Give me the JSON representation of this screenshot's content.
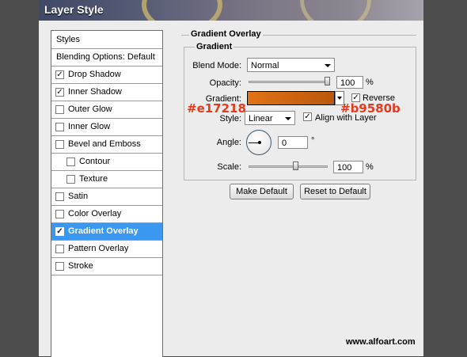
{
  "window": {
    "title": "Layer Style"
  },
  "styles_list": {
    "header": "Styles",
    "blending_options": "Blending Options: Default",
    "items": [
      {
        "label": "Drop Shadow",
        "checked": true,
        "indent": false,
        "selected": false
      },
      {
        "label": "Inner Shadow",
        "checked": true,
        "indent": false,
        "selected": false
      },
      {
        "label": "Outer Glow",
        "checked": false,
        "indent": false,
        "selected": false
      },
      {
        "label": "Inner Glow",
        "checked": false,
        "indent": false,
        "selected": false
      },
      {
        "label": "Bevel and Emboss",
        "checked": false,
        "indent": false,
        "selected": false
      },
      {
        "label": "Contour",
        "checked": false,
        "indent": true,
        "selected": false
      },
      {
        "label": "Texture",
        "checked": false,
        "indent": true,
        "selected": false
      },
      {
        "label": "Satin",
        "checked": false,
        "indent": false,
        "selected": false
      },
      {
        "label": "Color Overlay",
        "checked": false,
        "indent": false,
        "selected": false
      },
      {
        "label": "Gradient Overlay",
        "checked": true,
        "indent": false,
        "selected": true
      },
      {
        "label": "Pattern Overlay",
        "checked": false,
        "indent": false,
        "selected": false
      },
      {
        "label": "Stroke",
        "checked": false,
        "indent": false,
        "selected": false
      }
    ]
  },
  "gradient_overlay": {
    "section_title": "Gradient Overlay",
    "group_title": "Gradient",
    "blend_mode": {
      "label": "Blend Mode:",
      "value": "Normal"
    },
    "opacity": {
      "label": "Opacity:",
      "value": "100",
      "unit": "%",
      "level": 1.0
    },
    "gradient": {
      "label": "Gradient:",
      "start_color": "#e17218",
      "end_color": "#b9580b",
      "reverse_label": "Reverse",
      "reverse_checked": true
    },
    "style": {
      "label": "Style:",
      "value": "Linear",
      "align_label": "Align with Layer",
      "align_checked": true
    },
    "angle": {
      "label": "Angle:",
      "value": "0",
      "unit": "°"
    },
    "scale": {
      "label": "Scale:",
      "value": "100",
      "unit": "%",
      "level": 0.6
    },
    "buttons": {
      "make_default": "Make Default",
      "reset_default": "Reset to Default"
    }
  },
  "annotations": {
    "left_color": "#e17218",
    "right_color": "#b9580b"
  },
  "watermark": "www.alfoart.com"
}
